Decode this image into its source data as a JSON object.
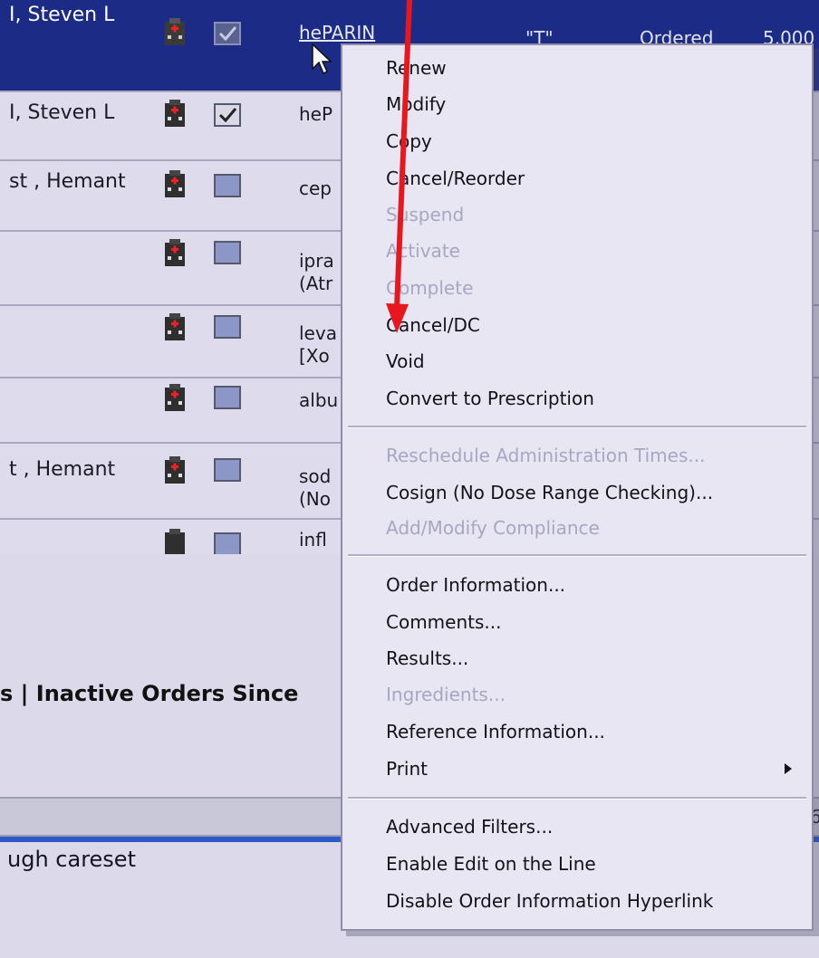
{
  "orders_grid": {
    "rows": [
      {
        "name": "I, Steven L",
        "drug": "hePARIN",
        "checked": true
      },
      {
        "name": "I, Steven L",
        "drug": "heP",
        "checked": true
      },
      {
        "name": "st , Hemant",
        "drug": "cep",
        "checked": false
      },
      {
        "name": "",
        "drug": "ipra\n(Atr",
        "checked": false
      },
      {
        "name": "",
        "drug": "leva\n[Xo",
        "checked": false
      },
      {
        "name": "",
        "drug": "albu",
        "checked": false
      },
      {
        "name": "t , Hemant",
        "drug": "sod\n(No",
        "checked": false
      },
      {
        "name": "",
        "drug": "infl",
        "checked": false
      }
    ],
    "header_extra": {
      "flag": "\"T\"",
      "status": "Ordered",
      "dose": "5,000"
    }
  },
  "tabs_text": "s  |  Inactive Orders Since",
  "careset_text": "ugh careset",
  "right_edge_digit": "6",
  "context_menu": {
    "groups": [
      [
        {
          "label": "Renew",
          "enabled": true
        },
        {
          "label": "Modify",
          "enabled": true
        },
        {
          "label": "Copy",
          "enabled": true
        },
        {
          "label": "Cancel/Reorder",
          "enabled": true
        },
        {
          "label": "Suspend",
          "enabled": false
        },
        {
          "label": "Activate",
          "enabled": false
        },
        {
          "label": "Complete",
          "enabled": false
        },
        {
          "label": "Cancel/DC",
          "enabled": true
        },
        {
          "label": "Void",
          "enabled": true
        },
        {
          "label": "Convert to Prescription",
          "enabled": true
        }
      ],
      [
        {
          "label": "Reschedule Administration Times...",
          "enabled": false
        },
        {
          "label": "Cosign (No Dose Range Checking)...",
          "enabled": true
        },
        {
          "label": "Add/Modify Compliance",
          "enabled": false
        }
      ],
      [
        {
          "label": "Order Information...",
          "enabled": true
        },
        {
          "label": "Comments...",
          "enabled": true
        },
        {
          "label": "Results...",
          "enabled": true
        },
        {
          "label": "Ingredients...",
          "enabled": false
        },
        {
          "label": "Reference Information...",
          "enabled": true
        },
        {
          "label": "Print",
          "enabled": true,
          "submenu": true
        }
      ],
      [
        {
          "label": "Advanced Filters...",
          "enabled": true
        },
        {
          "label": "Enable Edit on the Line",
          "enabled": true
        },
        {
          "label": "Disable Order Information Hyperlink",
          "enabled": true
        }
      ]
    ]
  },
  "colors": {
    "selected_row": "#1c2c86",
    "menu_bg": "#e8e6f2",
    "disabled_text": "#a6a7c2",
    "annotation": "#e8161f"
  },
  "icons": {
    "row_icon": "hospital-building-icon",
    "row_check": "checkbox-icon",
    "pointer": "mouse-pointer-icon",
    "annotation": "red-arrow-annotation",
    "submenu": "submenu-arrow-icon"
  }
}
